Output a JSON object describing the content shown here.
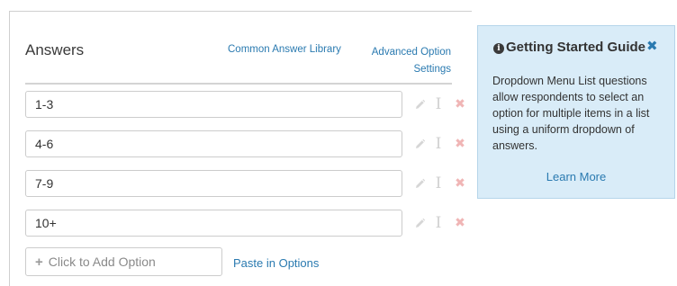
{
  "answers": {
    "title": "Answers",
    "common_library_link": "Common Answer Library",
    "advanced_settings_link_line1": "Advanced Option",
    "advanced_settings_link_line2": "Settings",
    "options": [
      {
        "value": "1-3"
      },
      {
        "value": "4-6"
      },
      {
        "value": "7-9"
      },
      {
        "value": "10+"
      }
    ],
    "row_icons": [
      "pencil-icon",
      "text-cursor-icon",
      "close-icon"
    ],
    "add_option_label": "Click to Add Option",
    "paste_options_link": "Paste in Options"
  },
  "guide": {
    "title": "Getting Started Guide",
    "body": "Dropdown Menu List questions allow respondents to select an option for multiple items in a list using a uniform dropdown of answers.",
    "learn_more": "Learn More",
    "icons": [
      "info-icon",
      "close-icon"
    ]
  },
  "colors": {
    "link": "#2a7ab0",
    "guide_bg": "#d9ecf8",
    "guide_border": "#b5d5ea",
    "delete_icon": "#f0b5b5",
    "muted_icon": "#d0d0d0"
  }
}
